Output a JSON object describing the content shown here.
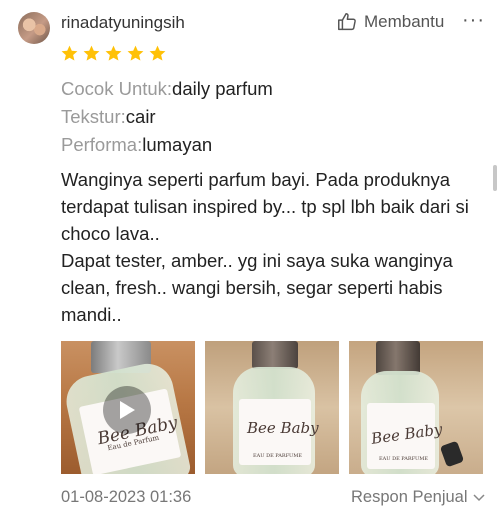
{
  "review": {
    "username": "rinadatyuningsih",
    "helpful_label": "Membantu",
    "more_label": "···",
    "rating": 5,
    "star_color": "#FFC107",
    "attributes": [
      {
        "key": "Cocok Untuk:",
        "value": "daily parfum"
      },
      {
        "key": "Tekstur:",
        "value": "cair"
      },
      {
        "key": "Performa:",
        "value": "lumayan"
      }
    ],
    "body_lines": [
      "Wanginya seperti parfum bayi. Pada produknya terdapat tulisan inspired by... tp spl lbh baik dari si choco lava..",
      "Dapat tester, amber.. yg ini saya suka wanginya clean, fresh.. wangi bersih, segar seperti habis mandi.."
    ],
    "media": [
      {
        "type": "video",
        "label_text": "Bee Baby",
        "sub_text": "Eau de Parfum"
      },
      {
        "type": "image",
        "label_text": "Bee Baby",
        "sub_text": "EAU DE PARFUME"
      },
      {
        "type": "image",
        "label_text": "Bee Baby",
        "sub_text": "EAU DE PARFUME"
      }
    ],
    "date": "01-08-2023 01:36",
    "seller_response_label": "Respon Penjual"
  }
}
